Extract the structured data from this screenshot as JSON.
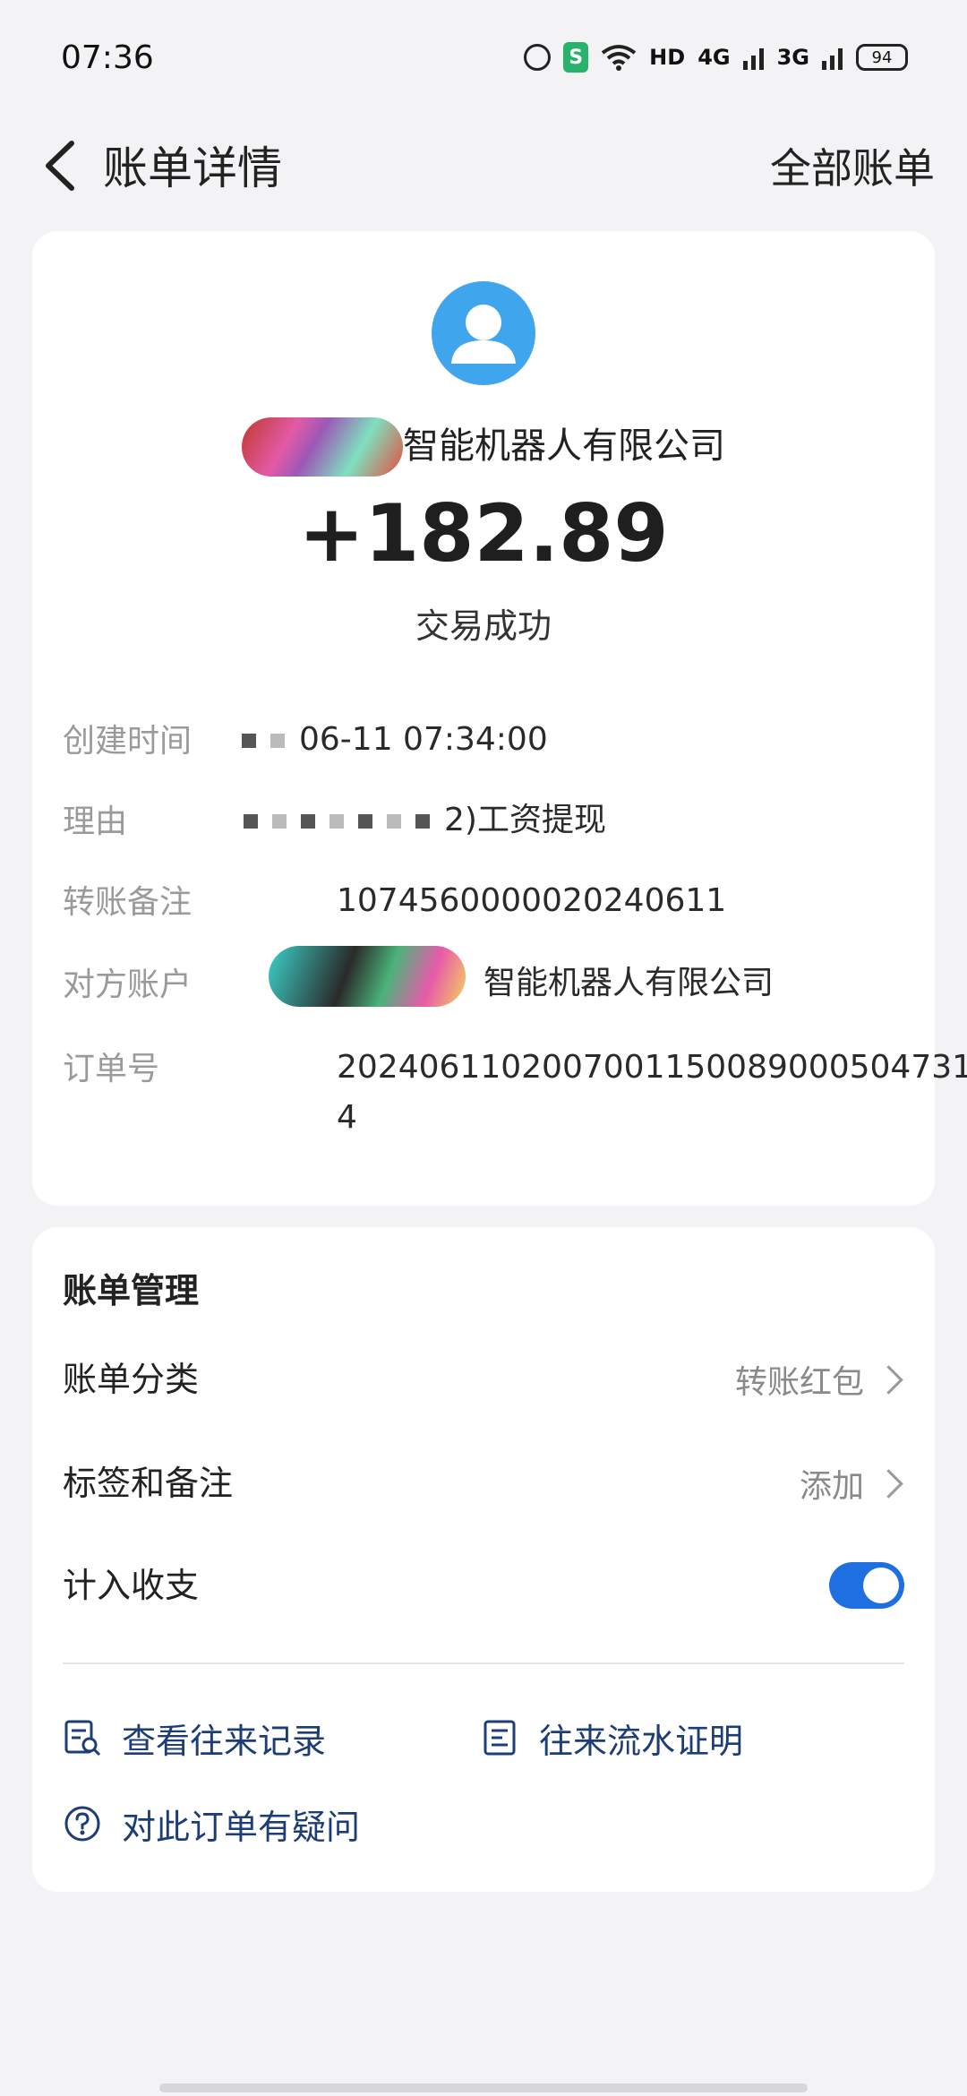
{
  "status_bar": {
    "time": "07:36",
    "network": "HD",
    "sig1": "4G",
    "sig2": "3G",
    "battery": "94",
    "icons": [
      "alarm-icon",
      "shield-app-icon",
      "wifi-icon",
      "signal-icon",
      "signal-icon",
      "battery-icon"
    ]
  },
  "nav": {
    "title": "账单详情",
    "right_link": "全部账单",
    "back_icon": "chevron-left-icon"
  },
  "bill": {
    "avatar_icon": "user-icon",
    "payee_visible": "智能机器人有限公司",
    "amount": "+182.89",
    "status": "交易成功",
    "details": [
      {
        "label": "创建时间",
        "value": "06-11 07:34:00"
      },
      {
        "label": "理由",
        "value": "2)工资提现"
      },
      {
        "label": "转账备注",
        "value": "1074560000020240611"
      },
      {
        "label": "对方账户",
        "value": "智能机器人有限公司"
      },
      {
        "label": "订单号",
        "value": "2024061102007001150089000504731",
        "value_cont": "4"
      }
    ]
  },
  "management": {
    "title": "账单管理",
    "category": {
      "label": "账单分类",
      "value": "转账红包"
    },
    "tags": {
      "label": "标签和备注",
      "value": "添加"
    },
    "include": {
      "label": "计入收支",
      "enabled": true
    },
    "links": [
      {
        "label": "查看往来记录",
        "icon": "record-search-icon"
      },
      {
        "label": "往来流水证明",
        "icon": "document-icon"
      },
      {
        "label": "对此订单有疑问",
        "icon": "question-circle-icon"
      }
    ]
  },
  "colors": {
    "accent": "#1e6fe0",
    "avatar_bg": "#3fa6ee",
    "link": "#1c3d77",
    "page_bg": "#f3f3f5"
  }
}
